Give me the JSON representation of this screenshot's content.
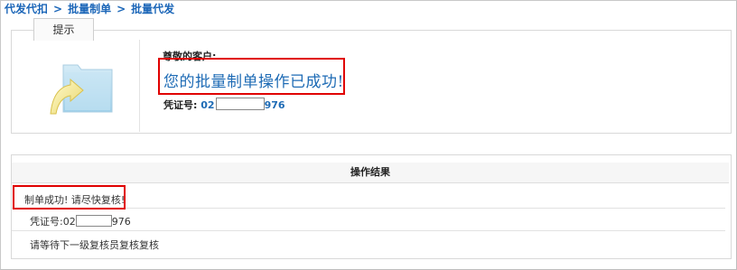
{
  "breadcrumb": {
    "items": [
      "代发代扣",
      "批量制单",
      "批量代发"
    ],
    "separator": ">"
  },
  "tip": {
    "tab_label": "提示",
    "greeting": "尊敬的客户:",
    "success_message": "您的批量制单操作已成功!",
    "voucher_label": "凭证号:",
    "voucher_prefix": "02",
    "voucher_suffix": "976"
  },
  "result": {
    "header": "操作结果",
    "message": "制单成功! 请尽快复核!",
    "voucher_label": "凭证号:",
    "voucher_prefix": "02",
    "voucher_suffix": "976",
    "instruction": "请等待下一级复核员复核复核"
  },
  "colors": {
    "link_blue": "#1b66b8",
    "highlight_red": "#e00000",
    "success_text": "#1e6bb5"
  },
  "icons": {
    "folder": "folder-upload-icon"
  }
}
